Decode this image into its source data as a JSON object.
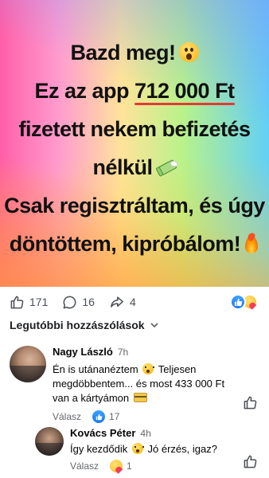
{
  "banner": {
    "line1": "Bazd meg!",
    "line2_prefix": "Ez az app ",
    "line2_amount": "712 000 Ft",
    "line3": "fizetett nekem befizetés",
    "line4": "nélkül",
    "line5": "Csak regisztráltam, és úgy",
    "line6": "döntöttem, kipróbálom!",
    "emojis": [
      "shocked-face",
      "money-with-wings",
      "fire"
    ],
    "underline_color": "#e53935"
  },
  "reaction_bar": {
    "like_count": "171",
    "comment_count": "16",
    "share_count": "4",
    "summary_reactions": [
      "like",
      "care"
    ]
  },
  "comments_header": {
    "label": "Legutóbbi hozzászólások"
  },
  "comments": [
    {
      "name": "Nagy László",
      "time": "7h",
      "text_before_emoji": "Én is utánanéztem",
      "text_after_emoji": "Teljesen megdöbbentem... és most 433 000 Ft van a kártyámon",
      "reply_label": "Válasz",
      "reaction_count": "17",
      "reaction_type": "like"
    },
    {
      "name": "Kovács Péter",
      "time": "4h",
      "text_before_emoji": "Így kezdődik",
      "text_after_emoji": "Jó érzés, igaz?",
      "reply_label": "Válasz",
      "reaction_count": "1",
      "reaction_type": "care"
    }
  ],
  "colors": {
    "facebook_blue": "#1877f2",
    "secondary_text": "#65676b",
    "care_yellow": "#f7b928"
  }
}
